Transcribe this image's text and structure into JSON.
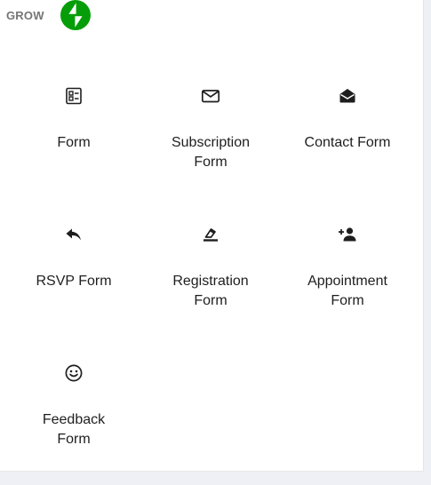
{
  "header": {
    "title": "GROW",
    "logo_icon": "jetpack-bolt-icon",
    "logo_color": "#069e08"
  },
  "blocks": [
    {
      "label": "Form",
      "icon": "form-icon"
    },
    {
      "label": "Subscription\nForm",
      "icon": "envelope-icon"
    },
    {
      "label": "Contact Form",
      "icon": "open-envelope-icon"
    },
    {
      "label": "RSVP Form",
      "icon": "reply-arrow-icon"
    },
    {
      "label": "Registration\nForm",
      "icon": "eraser-pen-icon"
    },
    {
      "label": "Appointment\nForm",
      "icon": "add-person-icon"
    },
    {
      "label": "Feedback\nForm",
      "icon": "smiley-icon"
    }
  ]
}
